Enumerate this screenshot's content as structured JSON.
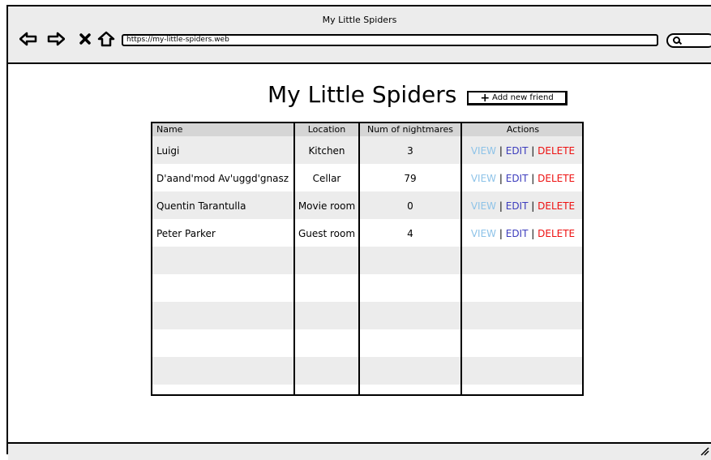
{
  "window": {
    "title": "My Little Spiders"
  },
  "browser": {
    "url": "https://my-little-spiders.web",
    "nav_icons": [
      "back-arrow-icon",
      "forward-arrow-icon",
      "close-x-icon",
      "home-icon"
    ],
    "search_icon": "search-icon"
  },
  "page": {
    "title": "My Little Spiders",
    "add_button": {
      "icon": "+",
      "label": "Add new friend"
    }
  },
  "table": {
    "headers": [
      "Name",
      "Location",
      "Num of nightmares",
      "Actions"
    ],
    "rows": [
      {
        "name": "Luigi",
        "location": "Kitchen",
        "nightmares": "3"
      },
      {
        "name": "D'aand'mod Av'uggd'gnasz",
        "location": "Cellar",
        "nightmares": "79"
      },
      {
        "name": "Quentin Tarantulla",
        "location": "Movie room",
        "nightmares": "0"
      },
      {
        "name": "Peter Parker",
        "location": "Guest room",
        "nightmares": "4"
      }
    ],
    "actions": {
      "view": "VIEW",
      "edit": "EDIT",
      "delete": "DELETE",
      "separator": "|"
    },
    "colors": {
      "view": "#8ec3e8",
      "edit": "#3d3dbd",
      "delete": "#ee1111",
      "stripe": "#ececec",
      "header": "#d5d5d5"
    }
  }
}
